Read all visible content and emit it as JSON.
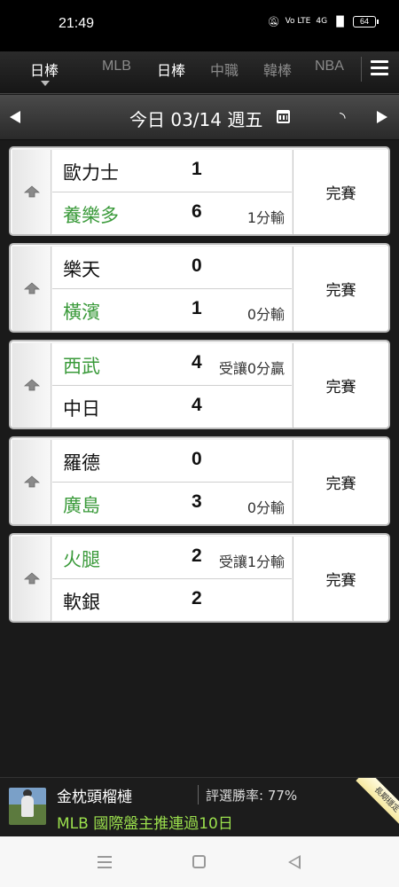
{
  "status_bar": {
    "time": "21:49",
    "network": "4G",
    "volte": "Vo LTE",
    "battery": "64"
  },
  "league_tabs": {
    "selected_label": "日棒",
    "items": [
      {
        "label": "MLB",
        "highlight": false
      },
      {
        "label": "日棒",
        "highlight": true
      },
      {
        "label": "中職",
        "highlight": false
      },
      {
        "label": "韓棒",
        "highlight": false
      },
      {
        "label": "NBA",
        "highlight": false
      }
    ]
  },
  "date_bar": {
    "date_label": "今日 03/14 週五"
  },
  "games": [
    {
      "team1": {
        "name": "歐力士",
        "score": "1",
        "note": "",
        "green": false
      },
      "team2": {
        "name": "養樂多",
        "score": "6",
        "note": "1分輸",
        "green": true
      },
      "status": "完賽"
    },
    {
      "team1": {
        "name": "樂天",
        "score": "0",
        "note": "",
        "green": false
      },
      "team2": {
        "name": "橫濱",
        "score": "1",
        "note": "0分輸",
        "green": true
      },
      "status": "完賽"
    },
    {
      "team1": {
        "name": "西武",
        "score": "4",
        "note": "受讓0分贏",
        "green": true
      },
      "team2": {
        "name": "中日",
        "score": "4",
        "note": "",
        "green": false
      },
      "status": "完賽"
    },
    {
      "team1": {
        "name": "羅德",
        "score": "0",
        "note": "",
        "green": false
      },
      "team2": {
        "name": "廣島",
        "score": "3",
        "note": "0分輸",
        "green": true
      },
      "status": "完賽"
    },
    {
      "team1": {
        "name": "火腿",
        "score": "2",
        "note": "受讓1分輸",
        "green": true
      },
      "team2": {
        "name": "軟銀",
        "score": "2",
        "note": "",
        "green": false
      },
      "status": "完賽"
    }
  ],
  "ad_banner": {
    "name": "金枕頭榴槤",
    "rate": "評選勝率: 77%",
    "headline": "MLB 國際盤主推連過10日",
    "ribbon": "長期穩定"
  },
  "colors": {
    "green_team": "#3a9a3a",
    "ad_headline": "#9be04d"
  }
}
